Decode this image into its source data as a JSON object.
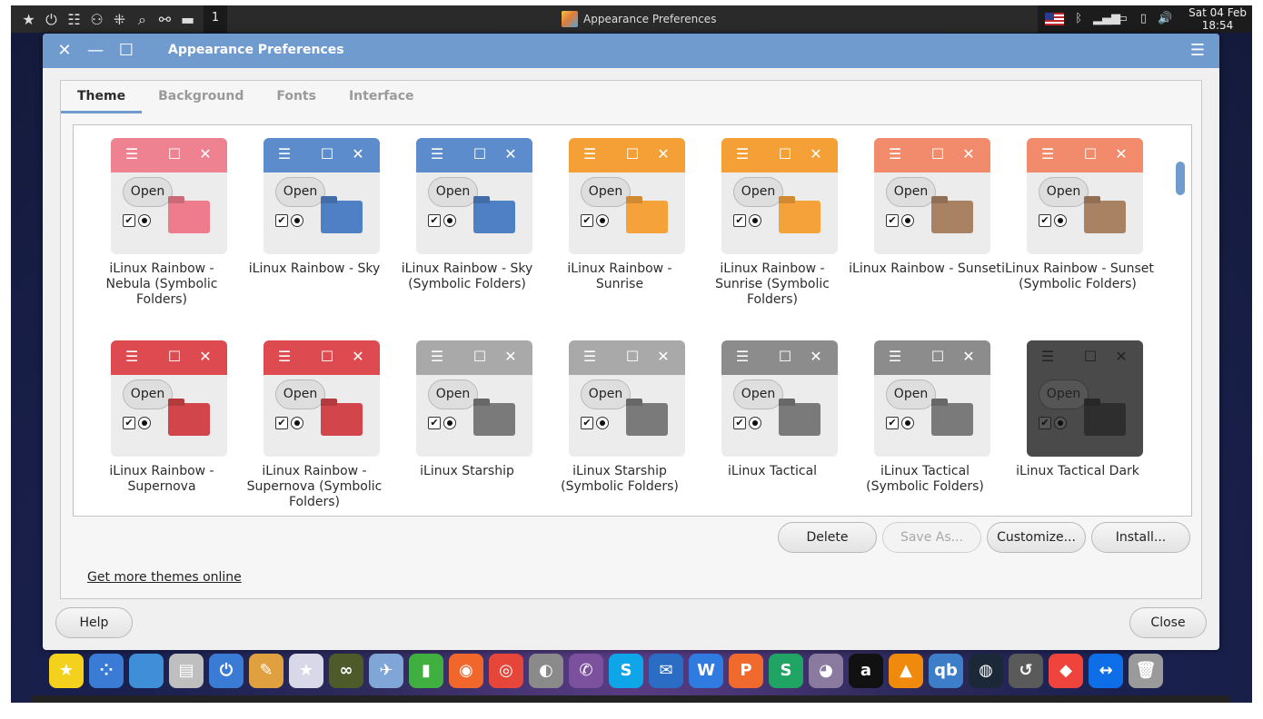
{
  "top_panel": {
    "workspace": "1",
    "task_title": "Appearance Preferences",
    "clock_line1": "Sat 04 Feb",
    "clock_line2": "18:54",
    "left_icons": [
      "star-icon",
      "power-icon",
      "toggle-icon",
      "people-icon",
      "apps-grid-icon",
      "search-icon",
      "graph-icon",
      "folder-icon",
      "desktop-icon"
    ],
    "tray_icons": [
      "flag-us-icon",
      "bluetooth-icon",
      "signal-icon",
      "battery-icon",
      "phone-icon",
      "volume-icon"
    ]
  },
  "window": {
    "title": "Appearance Preferences",
    "tabs": [
      {
        "label": "Theme",
        "active": true
      },
      {
        "label": "Background",
        "active": false
      },
      {
        "label": "Fonts",
        "active": false
      },
      {
        "label": "Interface",
        "active": false
      }
    ],
    "preview_open_label": "Open",
    "themes": [
      {
        "name": "iLinux Rainbow - Nebula (Symbolic Folders)",
        "bar_color": "#ef8290",
        "folder_color": "#ee7c8c"
      },
      {
        "name": "iLinux Rainbow - Sky",
        "bar_color": "#5d8ccd",
        "folder_color": "#4f80c6"
      },
      {
        "name": "iLinux Rainbow - Sky (Symbolic Folders)",
        "bar_color": "#5d8ccd",
        "folder_color": "#4f80c6"
      },
      {
        "name": "iLinux Rainbow - Sunrise",
        "bar_color": "#f4a036",
        "folder_color": "#f5a23a"
      },
      {
        "name": "iLinux Rainbow - Sunrise (Symbolic Folders)",
        "bar_color": "#f4a036",
        "folder_color": "#f5a23a"
      },
      {
        "name": "iLinux Rainbow - Sunset",
        "bar_color": "#f28b6b",
        "folder_color": "#a98264"
      },
      {
        "name": "iLinux Rainbow - Sunset (Symbolic Folders)",
        "bar_color": "#f28b6b",
        "folder_color": "#a98264"
      },
      {
        "name": "iLinux Rainbow - Supernova",
        "bar_color": "#dd4a4f",
        "folder_color": "#d2454a"
      },
      {
        "name": "iLinux Rainbow - Supernova (Symbolic Folders)",
        "bar_color": "#dd4a4f",
        "folder_color": "#d2454a"
      },
      {
        "name": "iLinux Starship",
        "bar_color": "#a9a9a9",
        "folder_color": "#7a7a7a"
      },
      {
        "name": "iLinux Starship (Symbolic Folders)",
        "bar_color": "#a9a9a9",
        "folder_color": "#7a7a7a"
      },
      {
        "name": "iLinux Tactical",
        "bar_color": "#8c8c8c",
        "folder_color": "#7a7a7a"
      },
      {
        "name": "iLinux Tactical (Symbolic Folders)",
        "bar_color": "#8c8c8c",
        "folder_color": "#7a7a7a"
      },
      {
        "name": "iLinux Tactical Dark",
        "bar_color": "#4a4a4a",
        "folder_color": "#2e2e2e"
      }
    ],
    "actions": {
      "delete": "Delete",
      "save_as": "Save As...",
      "customize": "Customize...",
      "install": "Install..."
    },
    "more_link": "Get more themes online",
    "help": "Help",
    "close": "Close"
  },
  "dock": {
    "icons": [
      {
        "name": "favorites-star-icon",
        "color": "#f3d11c",
        "glyph": "★"
      },
      {
        "name": "launcher-dots-icon",
        "color": "#3a7bd5",
        "glyph": "⁘"
      },
      {
        "name": "desktop-icon",
        "color": "#3e8fd8",
        "glyph": ""
      },
      {
        "name": "file-cabinet-icon",
        "color": "#bfbfbf",
        "glyph": "▤"
      },
      {
        "name": "settings-toggle-icon",
        "color": "#3a7bd5",
        "glyph": "⏻"
      },
      {
        "name": "appearance-icon",
        "color": "#e0a040",
        "glyph": "✎"
      },
      {
        "name": "software-store-icon",
        "color": "#d8d8e8",
        "glyph": "★"
      },
      {
        "name": "binoculars-icon",
        "color": "#4e5a2a",
        "glyph": "∞"
      },
      {
        "name": "plane-icon",
        "color": "#7fa6d6",
        "glyph": "✈"
      },
      {
        "name": "green-pipe-icon",
        "color": "#3fb03f",
        "glyph": "▮"
      },
      {
        "name": "firefox-icon",
        "color": "#f1662a",
        "glyph": "◉"
      },
      {
        "name": "chrome-icon",
        "color": "#e6463a",
        "glyph": "◎"
      },
      {
        "name": "google-earth-pro-icon",
        "color": "#8a8a8a",
        "glyph": "◐"
      },
      {
        "name": "viber-icon",
        "color": "#7b519d",
        "glyph": "✆"
      },
      {
        "name": "skype-icon",
        "color": "#0ea5e9",
        "glyph": "S"
      },
      {
        "name": "mail-icon",
        "color": "#2b6cc4",
        "glyph": "✉"
      },
      {
        "name": "wps-writer-icon",
        "color": "#2f7be0",
        "glyph": "W"
      },
      {
        "name": "wps-presentation-icon",
        "color": "#f06a2e",
        "glyph": "P"
      },
      {
        "name": "wps-spreadsheet-icon",
        "color": "#1fa463",
        "glyph": "S"
      },
      {
        "name": "webcam-icon",
        "color": "#8a7aa0",
        "glyph": "◕"
      },
      {
        "name": "anydesk-a-icon",
        "color": "#111111",
        "glyph": "a"
      },
      {
        "name": "vlc-icon",
        "color": "#f08a0c",
        "glyph": "▲"
      },
      {
        "name": "qbittorrent-icon",
        "color": "#3c7fc8",
        "glyph": "qb"
      },
      {
        "name": "steam-icon",
        "color": "#1b2838",
        "glyph": "◍"
      },
      {
        "name": "timeshift-icon",
        "color": "#5a5a5a",
        "glyph": "↺"
      },
      {
        "name": "anydesk-icon",
        "color": "#ef443b",
        "glyph": "◆"
      },
      {
        "name": "teamviewer-icon",
        "color": "#0e6ee8",
        "glyph": "↔"
      },
      {
        "name": "trash-icon",
        "color": "#9a9a9a",
        "glyph": "🗑"
      }
    ]
  }
}
